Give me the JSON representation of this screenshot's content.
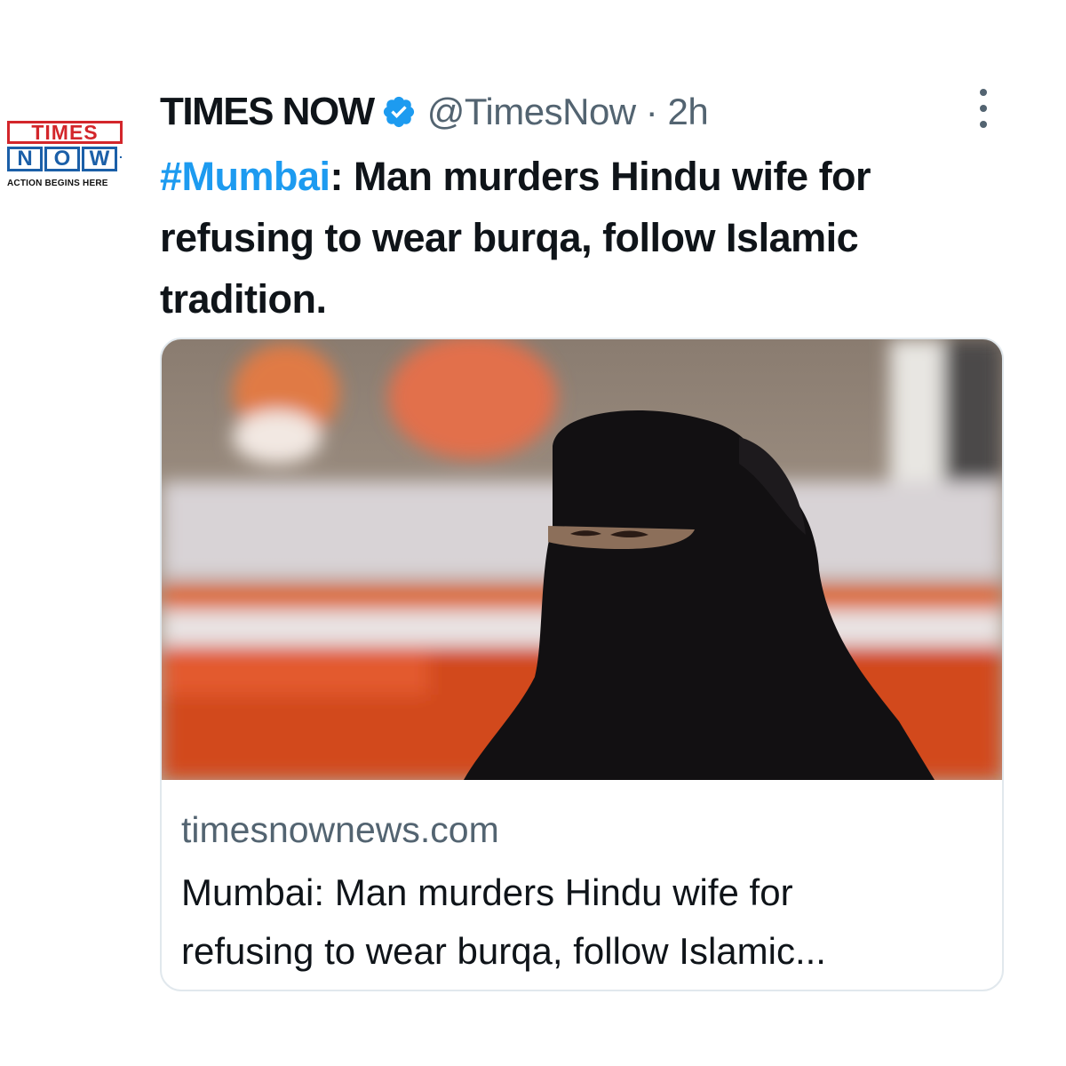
{
  "account": {
    "logo": {
      "line1": "TIMES",
      "line2": [
        "N",
        "O",
        "W"
      ],
      "tagline": "ACTION BEGINS HERE"
    },
    "display_name": "TIMES NOW",
    "verified_icon": "verified-badge-icon",
    "handle_time": "@TimesNow · 2h"
  },
  "tweet": {
    "hashtag": "#Mumbai",
    "text": ": Man murders Hindu wife for refusing to wear burqa, follow Islamic tradition."
  },
  "link_card": {
    "image_description_icon": "news-photo",
    "domain": "timesnownews.com",
    "title_line1": "Mumbai: Man murders Hindu wife for",
    "title_line2": "refusing to wear burqa, follow Islamic..."
  },
  "colors": {
    "accent": "#1d9bf0",
    "logo_red": "#d3262b",
    "logo_blue": "#1b5fa8",
    "muted": "#536471"
  }
}
